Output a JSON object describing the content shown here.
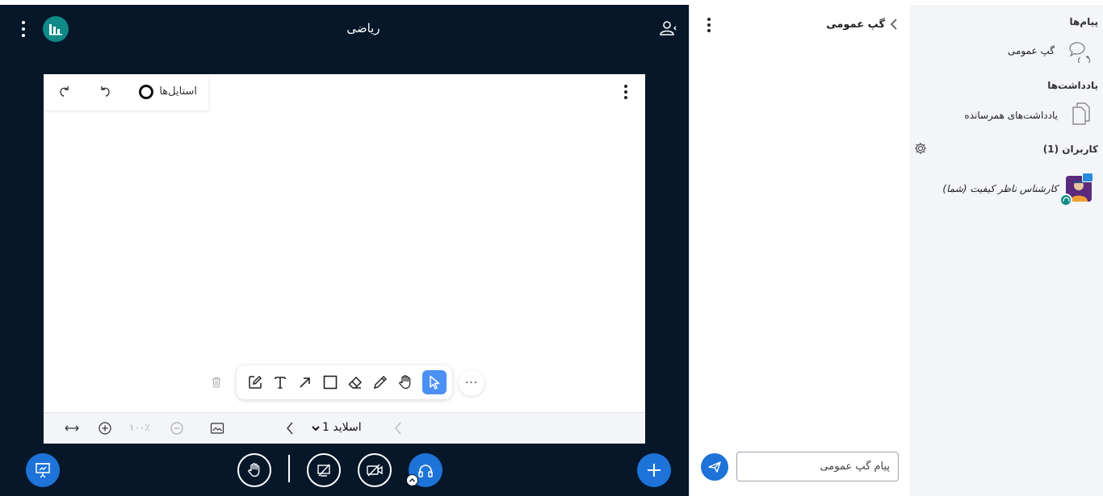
{
  "meeting": {
    "title": "ریاضی"
  },
  "whiteboard": {
    "styles_label": "استایل‌ها",
    "more_tools_label": "···",
    "zoom_value": "۱۰۰٪",
    "slide_label": "اسلاید 1"
  },
  "chat": {
    "title": "گپ عمومی",
    "input_placeholder": "پیام گپ عمومی"
  },
  "userlist": {
    "messages_heading": "پیام‌ها",
    "public_chat_label": "گپ عمومی",
    "notes_heading": "یادداشت‌ها",
    "shared_notes_label": "یادداشت‌های همرسانده",
    "users_heading": "کاربران (1)",
    "current_user_name": "کارشناس ناظر کیفیت (شما)"
  },
  "colors": {
    "meeting_bg": "#06172a",
    "accent_blue": "#1d73d8",
    "teal": "#0f8a86",
    "active_tool": "#4b90f5"
  }
}
